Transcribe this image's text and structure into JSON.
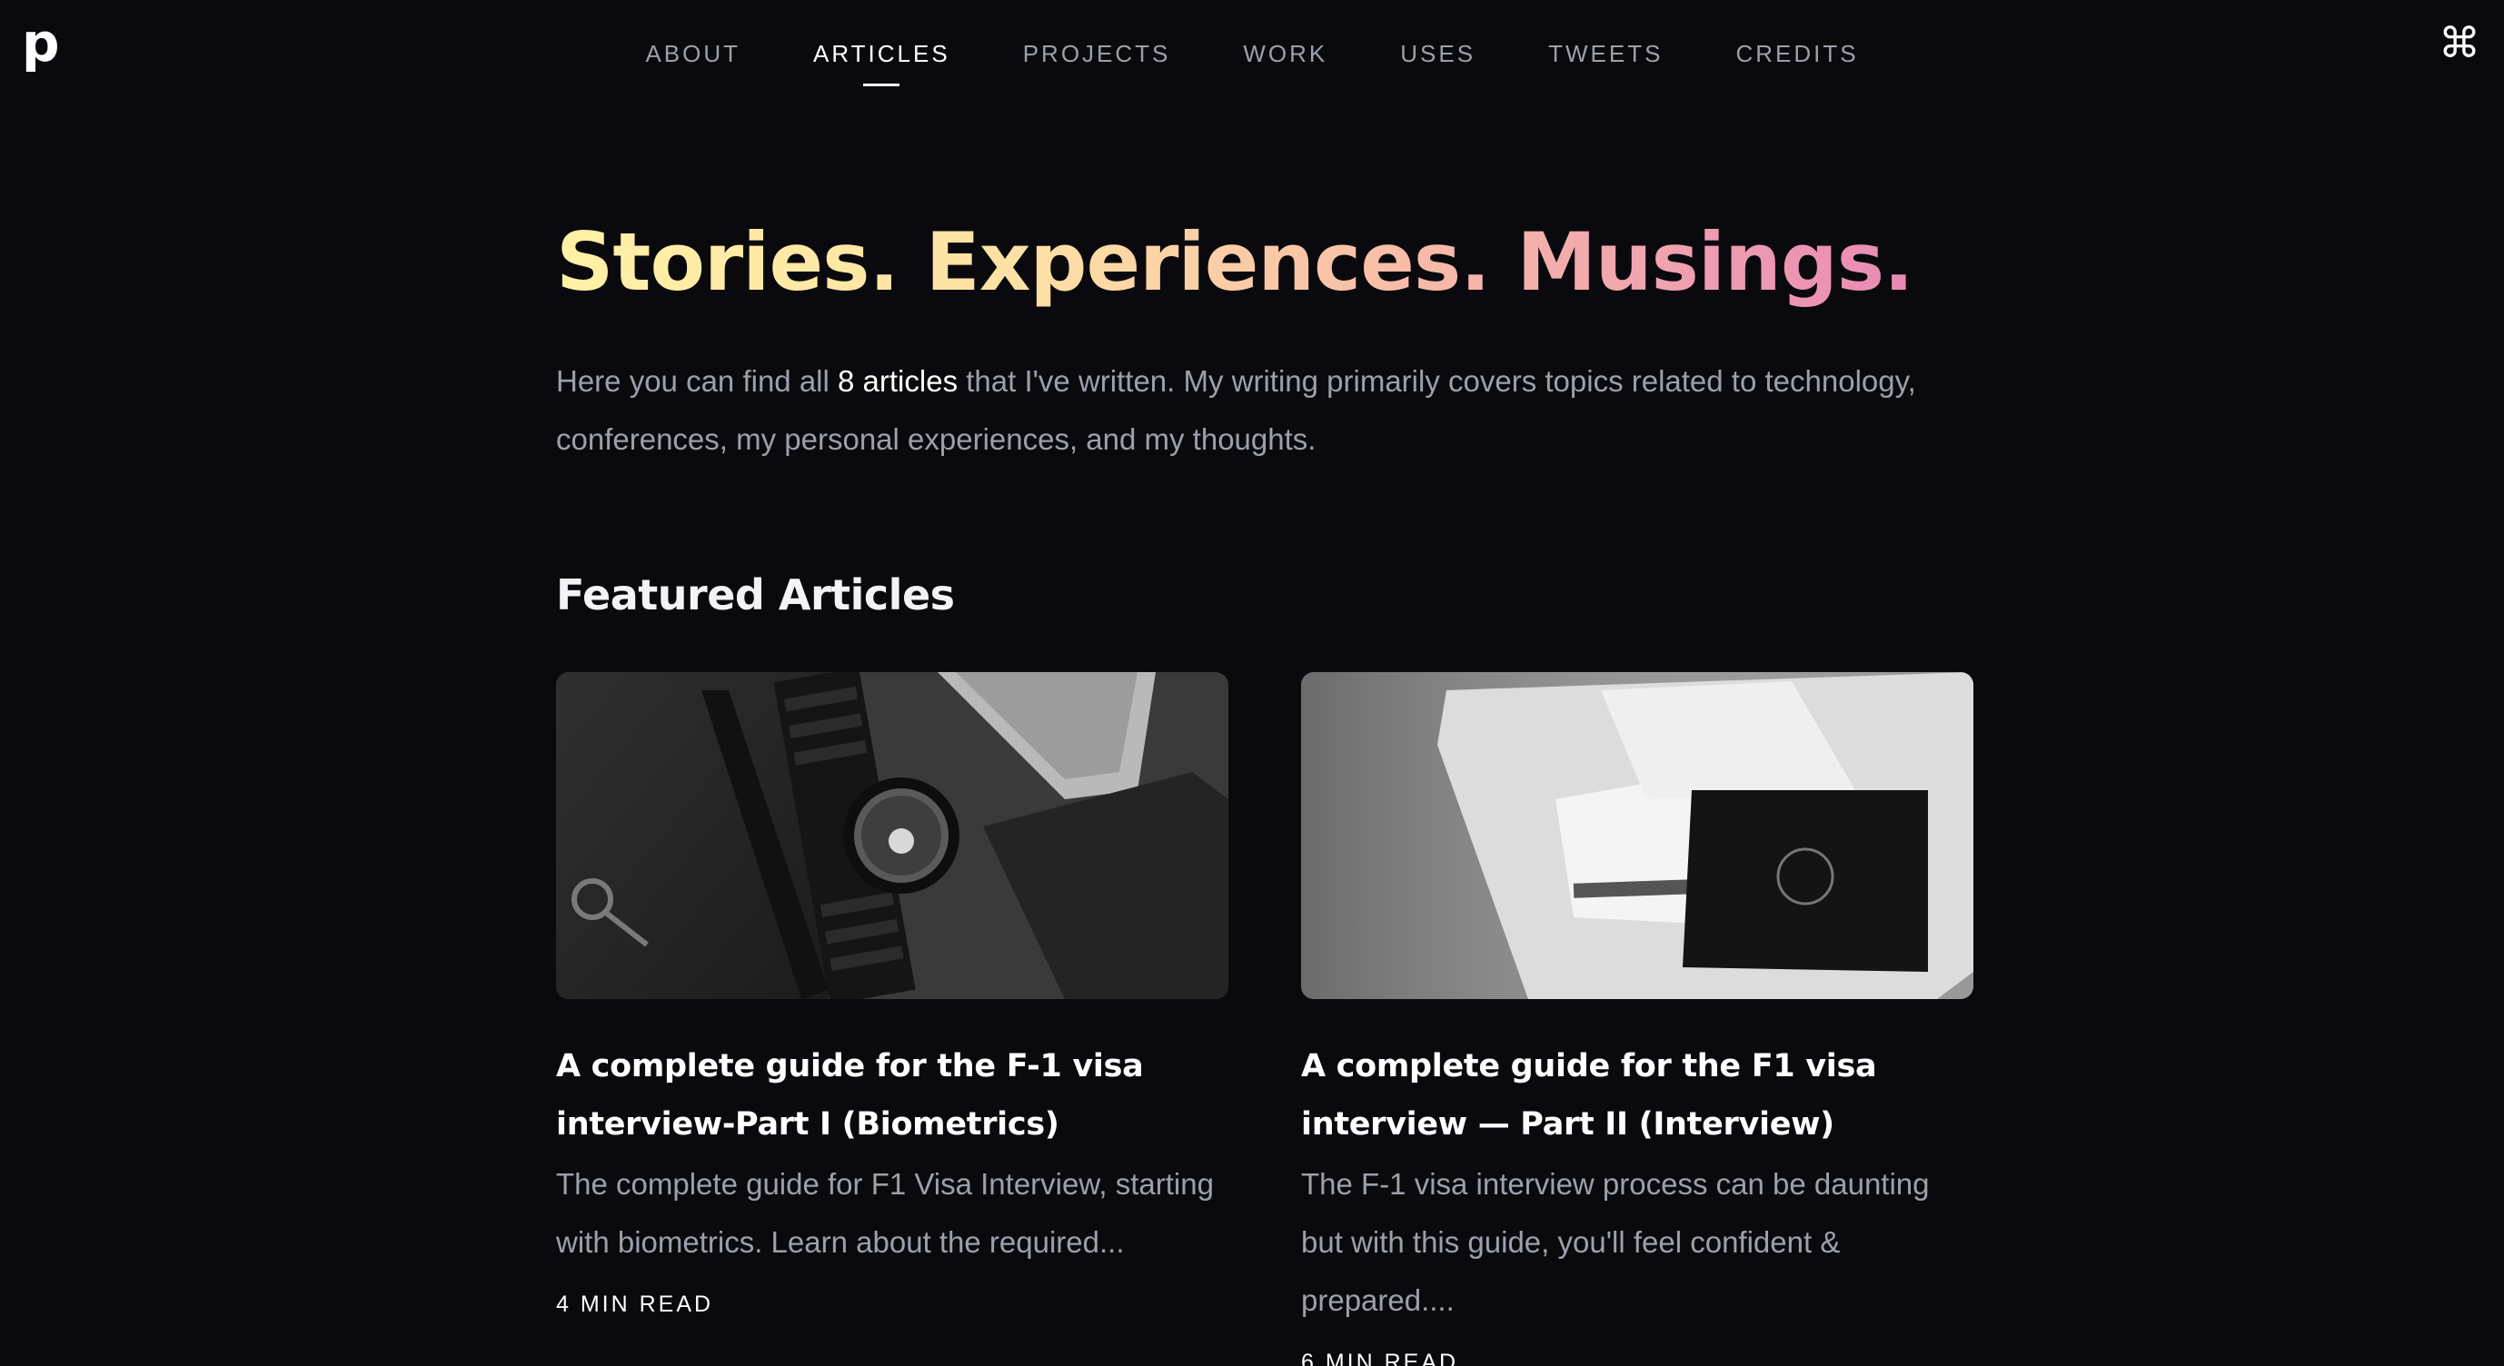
{
  "header": {
    "logo": "p",
    "nav": [
      {
        "label": "ABOUT",
        "active": false
      },
      {
        "label": "ARTICLES",
        "active": true
      },
      {
        "label": "PROJECTS",
        "active": false
      },
      {
        "label": "WORK",
        "active": false
      },
      {
        "label": "USES",
        "active": false
      },
      {
        "label": "TWEETS",
        "active": false
      },
      {
        "label": "CREDITS",
        "active": false
      }
    ],
    "command_icon": "⌘"
  },
  "hero": {
    "title": "Stories. Experiences. Musings.",
    "intro_before": "Here you can find all ",
    "intro_highlight": "8 articles",
    "intro_after": " that I've written. My writing primarily covers topics related to technology, conferences, my personal experiences, and my thoughts."
  },
  "featured": {
    "title": "Featured Articles",
    "articles": [
      {
        "title": "A complete guide for the F-1 visa interview-Part I (Biometrics)",
        "description": "The complete guide for F1 Visa Interview, starting with biometrics. Learn about the required...",
        "meta": "4 MIN READ",
        "image": "watch-passport-photo"
      },
      {
        "title": "A complete guide for the F1 visa interview — Part II (Interview)",
        "description": "The F-1 visa interview process can be daunting but with this guide, you'll feel confident & prepared....",
        "meta": "6 MIN READ",
        "image": "passport-boarding-pass-photo"
      }
    ]
  },
  "colors": {
    "background": "#0a0a0e",
    "muted_text": "#9ba0ab",
    "gradient_start": "#fff1a6",
    "gradient_end": "#e989b6"
  }
}
